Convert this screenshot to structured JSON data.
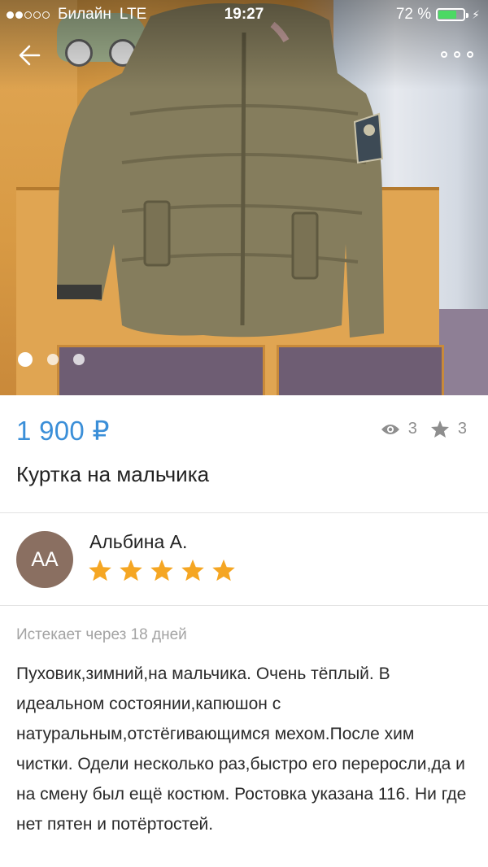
{
  "status_bar": {
    "signal_on": 2,
    "signal_total": 5,
    "carrier": "Билайн",
    "network": "LTE",
    "time": "19:27",
    "battery_text": "72 %",
    "battery_level": 0.72,
    "battery_color": "#4cd964"
  },
  "nav": {
    "back_icon": "arrow-left-icon",
    "more_icon": "more-horizontal-icon"
  },
  "gallery": {
    "photo_count": 3,
    "active_index": 0
  },
  "listing": {
    "price": "1 900 ₽",
    "price_color": "#3b8fd8",
    "views": "3",
    "favorites": "3",
    "title": "Куртка на мальчика",
    "expires": "Истекает через 18 дней",
    "description": "Пуховик,зимний,на мальчика. Очень тёплый. В идеальном состоянии,капюшон с натуральным,отстёгивающимся мехом.После хим чистки. Одели несколько раз,быстро его переросли,да и на смену был ещё костюм. Ростовка указана 116. Ни где нет пятен и потёртостей."
  },
  "seller": {
    "initials": "АА",
    "name": "Альбина А.",
    "rating": 5,
    "rating_max": 5,
    "avatar_color": "#8a6f61",
    "star_color": "#f5a623"
  }
}
